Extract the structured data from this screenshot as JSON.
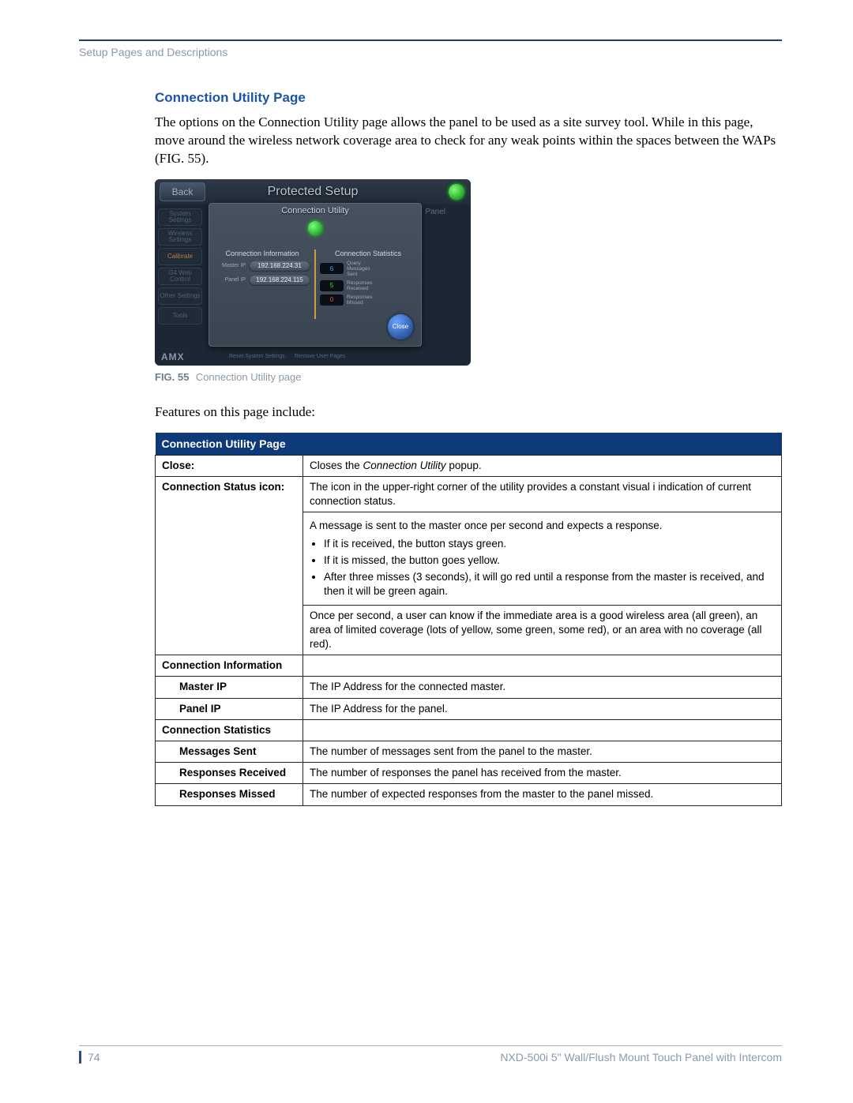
{
  "header": {
    "breadcrumb": "Setup Pages and Descriptions"
  },
  "section": {
    "title": "Connection Utility Page",
    "intro": "The options on the Connection Utility page allows the panel to be used as a site survey tool. While in this page, move around the wireless network coverage area to check for any weak points within the spaces between the WAPs (FIG. 55)."
  },
  "figure": {
    "label": "FIG. 55",
    "caption": "Connection Utility page"
  },
  "screenshot": {
    "window_title": "Protected Setup",
    "back_label": "Back",
    "panel_label": "Panel",
    "side_buttons": [
      "System Settings",
      "Wireless Settings",
      "Calibrate",
      "G4 Web Control",
      "Other Settings",
      "Tools"
    ],
    "popup_title": "Connection Utility",
    "col_left_title": "Connection Information",
    "col_right_title": "Connection Statistics",
    "master_ip_label": "Master IP",
    "master_ip_value": "192.168.224.31",
    "panel_ip_label": "Panel IP",
    "panel_ip_value": "192.168.224.115",
    "stat_rows": [
      {
        "value": "6",
        "cls": "blue",
        "label": "Query Messages Sent"
      },
      {
        "value": "5",
        "cls": "green",
        "label": "Responses Received"
      },
      {
        "value": "0",
        "cls": "red",
        "label": "Responses Missed"
      }
    ],
    "close_label": "Close",
    "bottom_buttons": [
      "Reset System Settings",
      "Remove User Pages"
    ],
    "logo": "AMX"
  },
  "features_lead": "Features on this page include:",
  "table": {
    "header": "Connection Utility Page",
    "rows": {
      "close_label": "Close:",
      "close_desc_pre": "Closes the ",
      "close_desc_em": "Connection Utility",
      "close_desc_post": " popup.",
      "status_label": "Connection Status icon:",
      "status_p1": "The icon in the upper-right corner of the utility provides a constant visual i indication of current connection status.",
      "status_p2": "A message is sent to the master once per second and expects a response.",
      "status_b1": "If it is received, the button stays green.",
      "status_b2": "If it is missed, the button goes yellow.",
      "status_b3": "After three misses (3 seconds), it will go red until a response from the master is received, and then it will be green again.",
      "status_p3": "Once per second, a user can know if the immediate area is a good wireless area (all green), an area of limited coverage (lots of yellow, some green, some red), or an area with no coverage (all red).",
      "ci_label": "Connection Information",
      "master_ip_label": "Master IP",
      "master_ip_desc": "The IP Address for the connected master.",
      "panel_ip_label": "Panel IP",
      "panel_ip_desc": "The IP Address for the panel.",
      "cs_label": "Connection Statistics",
      "msg_sent_label": "Messages Sent",
      "msg_sent_desc": "The number of messages sent from the panel to the master.",
      "resp_recv_label": "Responses Received",
      "resp_recv_desc": "The number of responses the panel has received from the master.",
      "resp_miss_label": "Responses Missed",
      "resp_miss_desc": "The number of expected responses from the master to the panel missed."
    }
  },
  "footer": {
    "page_no": "74",
    "doc_title": "NXD-500i 5\" Wall/Flush Mount Touch Panel with Intercom"
  }
}
